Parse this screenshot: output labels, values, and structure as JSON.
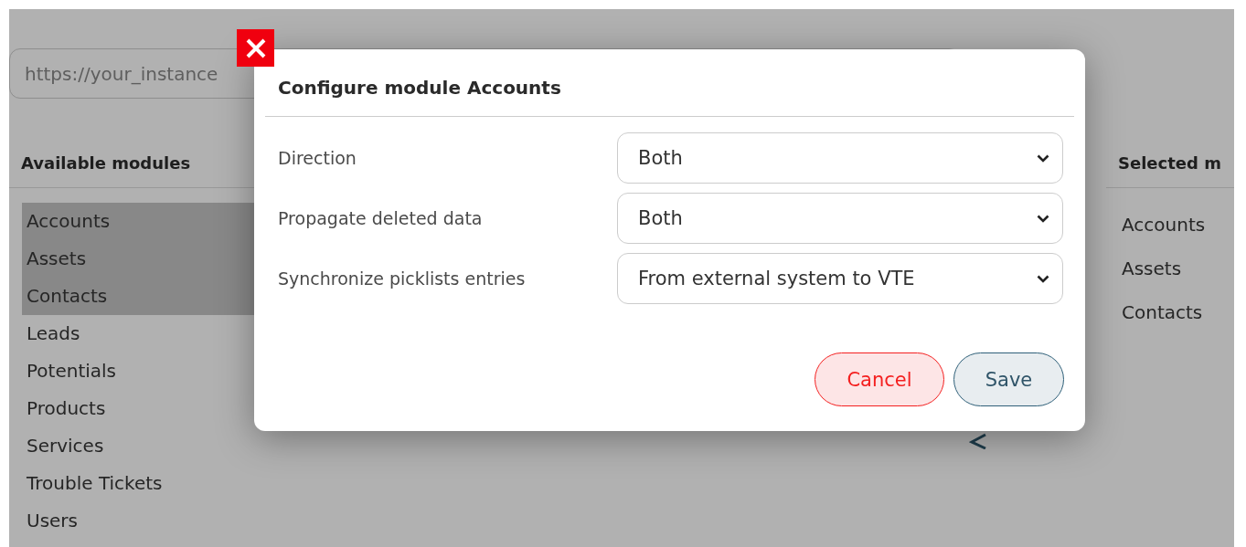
{
  "url_field": {
    "placeholder": "https://your_instance"
  },
  "available_modules": {
    "title": "Available modules",
    "items": [
      {
        "label": "Accounts",
        "selected": true
      },
      {
        "label": "Assets",
        "selected": true
      },
      {
        "label": "Contacts",
        "selected": true
      },
      {
        "label": "Leads",
        "selected": false
      },
      {
        "label": "Potentials",
        "selected": false
      },
      {
        "label": "Products",
        "selected": false
      },
      {
        "label": "Services",
        "selected": false
      },
      {
        "label": "Trouble Tickets",
        "selected": false
      },
      {
        "label": "Users",
        "selected": false
      }
    ]
  },
  "selected_modules": {
    "title": "Selected m",
    "items": [
      "Accounts",
      "Assets",
      "Contacts"
    ]
  },
  "dialog": {
    "title": "Configure module Accounts",
    "fields": [
      {
        "label": "Direction",
        "value": "Both"
      },
      {
        "label": "Propagate deleted data",
        "value": "Both"
      },
      {
        "label": "Synchronize picklists entries",
        "value": "From external system to VTE"
      }
    ],
    "buttons": [
      {
        "label": "Cancel",
        "kind": "cancel"
      },
      {
        "label": "Save",
        "kind": "save"
      }
    ]
  }
}
